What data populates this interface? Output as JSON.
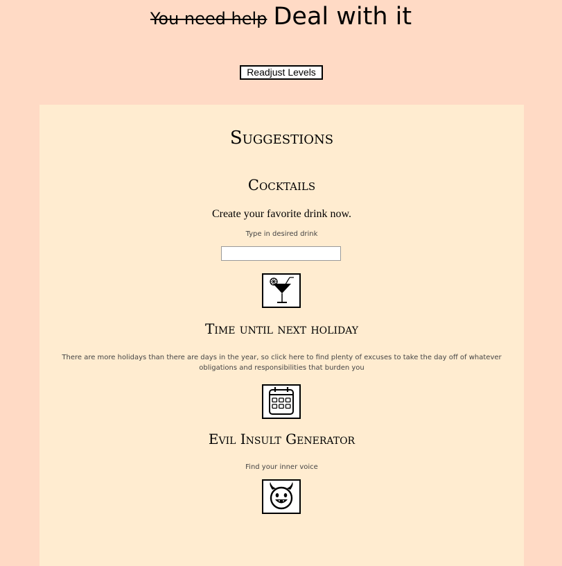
{
  "header": {
    "struck_text": "You need help",
    "headline": "Deal with it"
  },
  "controls": {
    "readjust_label": "Readjust Levels"
  },
  "panel": {
    "title": "Suggestions",
    "cocktails": {
      "title": "Cocktails",
      "tagline": "Create your favorite drink now.",
      "input_label": "Type in desired drink",
      "input_value": "",
      "icon": "cocktail-icon"
    },
    "holiday": {
      "title": "Time until next holiday",
      "description": "There are more holidays than there are days in the year, so click here to find plenty of excuses to take the day off of whatever obligations and responsibilities that burden you",
      "icon": "calendar-icon"
    },
    "insult": {
      "title": "Evil Insult Generator",
      "description": "Find your inner voice",
      "icon": "devil-face-icon"
    }
  },
  "colors": {
    "page_background": "#ffdac5",
    "panel_background": "#ffecd0"
  }
}
